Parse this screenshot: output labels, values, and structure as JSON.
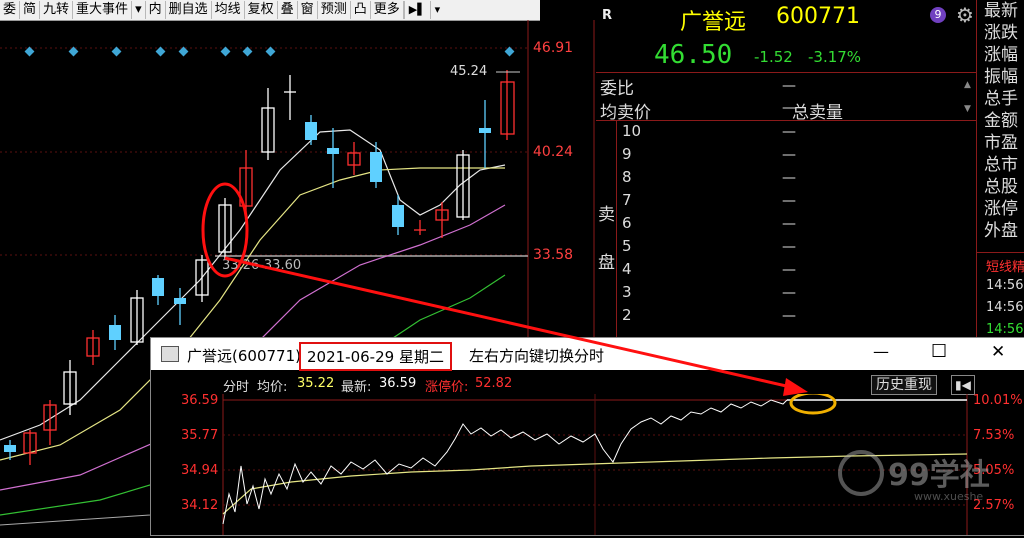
{
  "toolbar": {
    "items": [
      "委",
      "简",
      "九转",
      "重大事件",
      "内",
      "删自选",
      "均线",
      "复权",
      "叠",
      "窗",
      "预测",
      "凸",
      "更多"
    ]
  },
  "main_chart": {
    "price_levels": [
      "46.91",
      "40.24",
      "33.58"
    ],
    "high_label": "45.24",
    "low_label": "33.26-33.60"
  },
  "quote": {
    "r_label": "R",
    "name": "广誉远",
    "code": "600771",
    "price": "46.50",
    "change": "-1.52",
    "change_pct": "-3.17%",
    "weibi_label": "委比",
    "weibi_value": "—",
    "avg_sell_label": "均卖价",
    "avg_sell_value": "—",
    "total_sell_label": "总卖量",
    "sell_side_label": [
      "卖",
      "盘"
    ],
    "sell_levels": [
      "10",
      "9",
      "8",
      "7",
      "6",
      "5",
      "4",
      "3",
      "2"
    ],
    "level_dash": "—",
    "side_fields": [
      "最新",
      "涨跌",
      "涨幅",
      "振幅",
      "总手",
      "金额",
      "市盈",
      "总市",
      "总股",
      "涨停",
      "外盘"
    ],
    "short_label": "短线精",
    "short_times": [
      "14:56",
      "14:56",
      "14:56"
    ],
    "accent_red": "#ff3030",
    "accent_green": "#33dd33",
    "accent_yellow": "#ffff00"
  },
  "popup": {
    "title_prefix": "广誉远(600771)",
    "date": "2021-06-29 星期二",
    "hint": "左右方向键切换分时",
    "min_btn": "—",
    "max_btn": "☐",
    "close_btn": "✕",
    "fenshi_label": "分时",
    "avg_label": "均价:",
    "avg_value": "35.22",
    "latest_label": "最新:",
    "latest_value": "36.59",
    "limit_label": "涨停价:",
    "limit_value": "52.82",
    "history_btn": "历史重现",
    "y_left": [
      "36.59",
      "35.77",
      "34.94",
      "34.12"
    ],
    "y_right": [
      "10.01%",
      "7.53%",
      "5.05%",
      "2.57%"
    ]
  },
  "watermark": {
    "text": "99学社",
    "sub": "www.xueshe"
  }
}
